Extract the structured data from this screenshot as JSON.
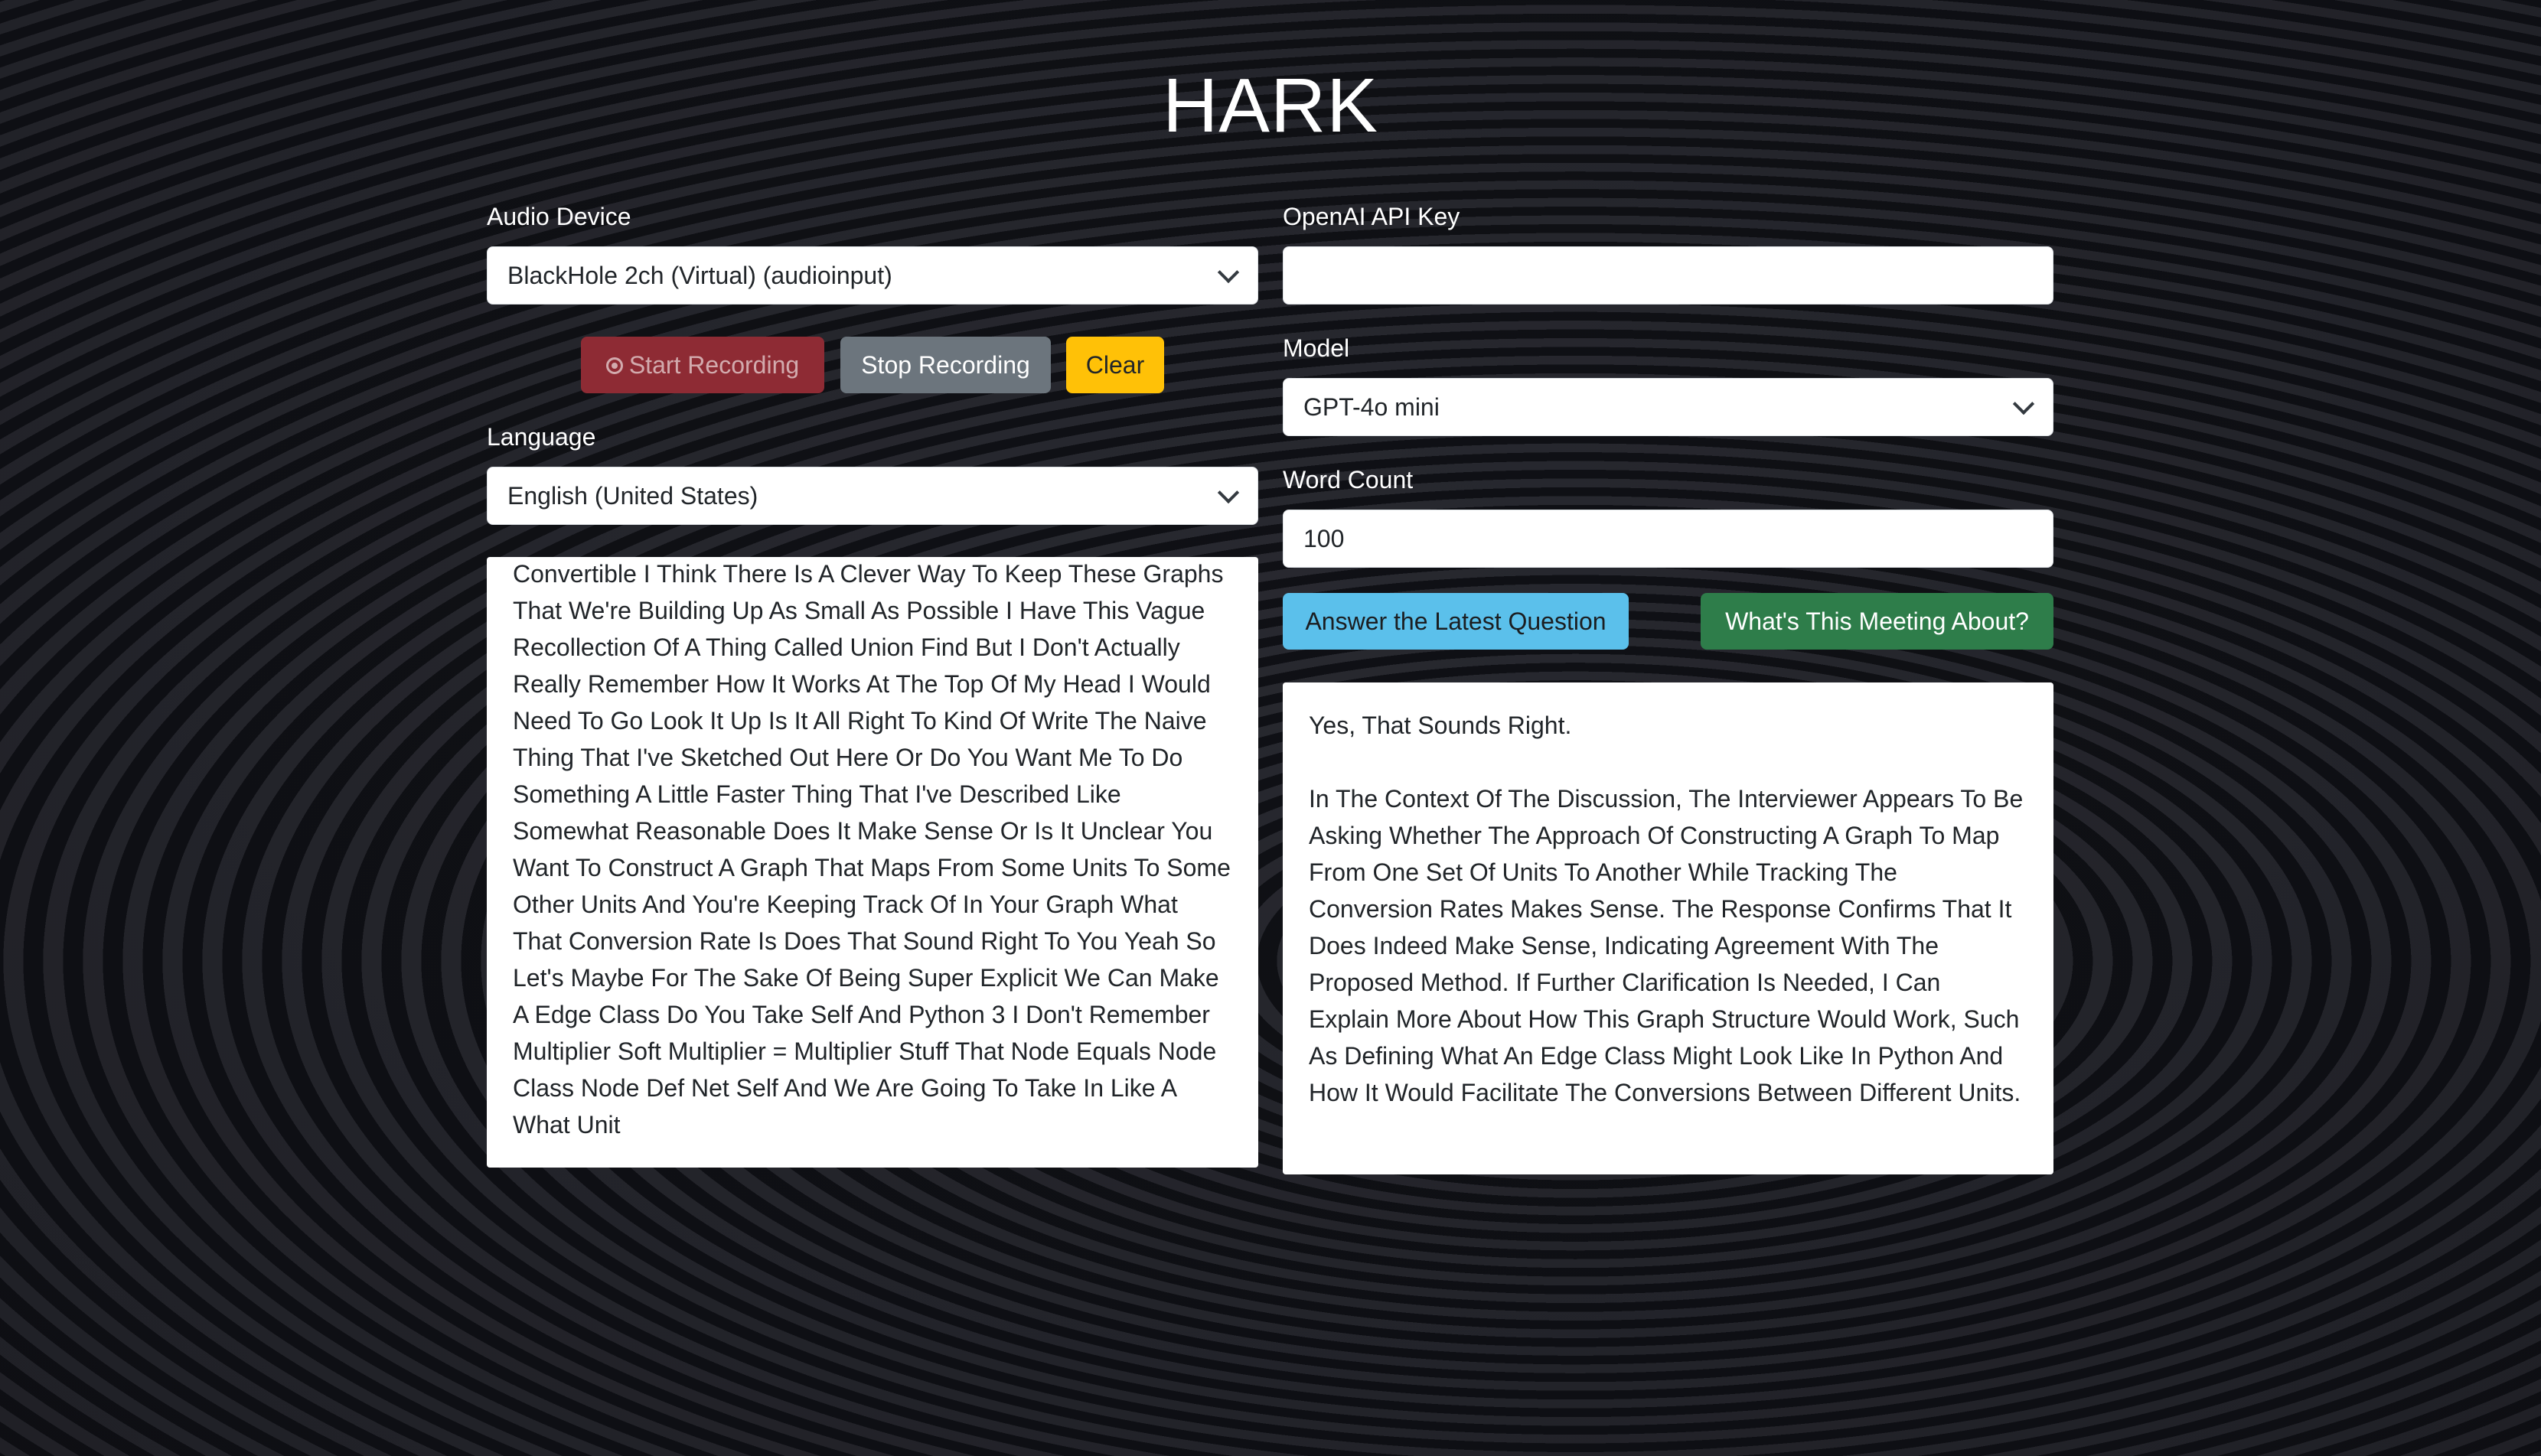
{
  "app": {
    "title": "HARK"
  },
  "left": {
    "audio_device": {
      "label": "Audio Device",
      "value": "BlackHole 2ch (Virtual) (audioinput)"
    },
    "buttons": {
      "start_label": "Start Recording",
      "stop_label": "Stop Recording",
      "clear_label": "Clear"
    },
    "language": {
      "label": "Language",
      "value": "English (United States)"
    },
    "transcript": "Convertible I Think There Is A Clever Way To Keep These Graphs That We're Building Up As Small As Possible I Have This Vague Recollection Of A Thing Called Union Find But I Don't Actually Really Remember How It Works At The Top Of My Head I Would Need To Go Look It Up Is It All Right To Kind Of Write The Naive Thing That I've Sketched Out Here Or Do You Want Me To Do Something A Little Faster Thing That I've Described Like Somewhat Reasonable Does It Make Sense Or Is It Unclear You Want To Construct A Graph That Maps From Some Units To Some Other Units And You're Keeping Track Of In Your Graph What That Conversion Rate Is Does That Sound Right To You Yeah So Let's Maybe For The Sake Of Being Super Explicit We Can Make A Edge Class Do You Take Self And Python 3 I Don't Remember Multiplier Soft Multiplier = Multiplier Stuff That Node Equals Node Class Node Def Net Self And We Are Going To Take In Like A What Unit"
  },
  "right": {
    "api_key": {
      "label": "OpenAI API Key",
      "value": ""
    },
    "model": {
      "label": "Model",
      "value": "GPT-4o mini"
    },
    "word_count": {
      "label": "Word Count",
      "value": "100"
    },
    "buttons": {
      "answer_label": "Answer the Latest Question",
      "meeting_label": "What's This Meeting About?"
    },
    "response": {
      "first_line": "Yes, That Sounds Right.",
      "body": "In The Context Of The Discussion, The Interviewer Appears To Be Asking Whether The Approach Of Constructing A Graph To Map From One Set Of Units To Another While Tracking The Conversion Rates Makes Sense. The Response Confirms That It Does Indeed Make Sense, Indicating Agreement With The Proposed Method. If Further Clarification Is Needed, I Can Explain More About How This Graph Structure Would Work, Such As Defining What An Edge Class Might Look Like In Python And How It Would Facilitate The Conversions Between Different Units."
    }
  },
  "colors": {
    "start_button": "#8e2b34",
    "stop_button": "#6c757d",
    "clear_button": "#ffc107",
    "answer_button": "#5bc0eb",
    "meeting_button": "#2e7d4a"
  },
  "icons": {
    "start_recording": "record-icon",
    "select_dropdown": "chevron-down-icon"
  }
}
